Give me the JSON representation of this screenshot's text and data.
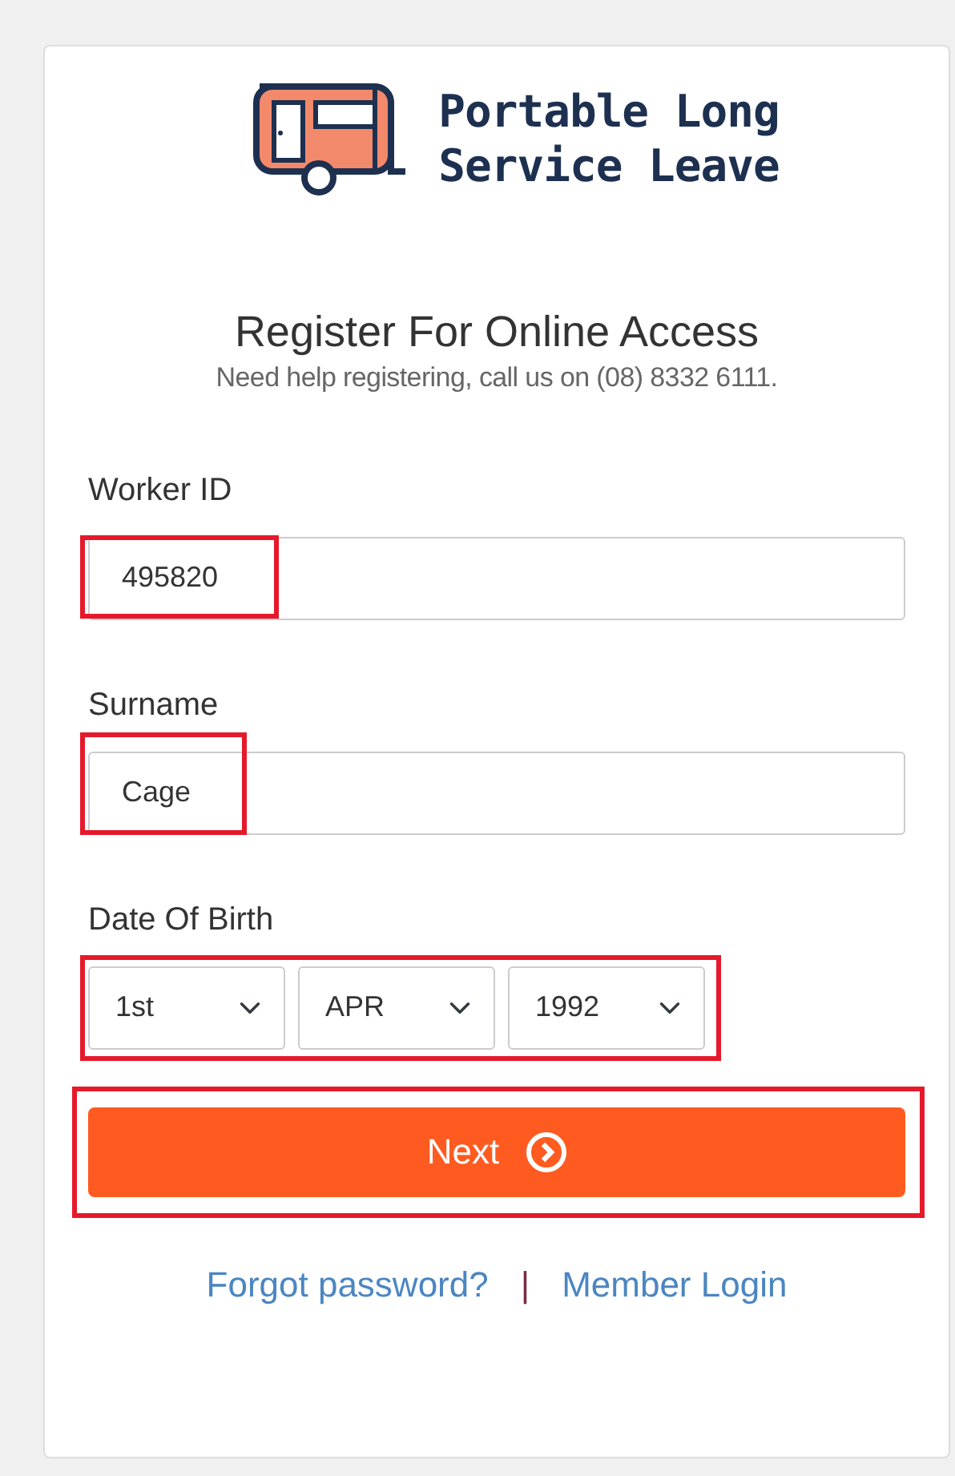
{
  "logo": {
    "lines": [
      "Portable Long",
      "Service Leave"
    ]
  },
  "heading": "Register For Online Access",
  "help_text": "Need help registering, call us on (08) 8332 6111.",
  "fields": [
    {
      "kind": "text",
      "label": "Worker ID",
      "value": "495820",
      "highlighted": true
    },
    {
      "kind": "text",
      "label": "Surname",
      "value": "Cage",
      "highlighted": true
    },
    {
      "kind": "date",
      "label": "Date Of Birth",
      "parts": [
        "1st",
        "APR",
        "1992"
      ],
      "highlighted": true
    }
  ],
  "next_button": {
    "label": "Next",
    "highlighted": true
  },
  "links": [
    "Forgot password?",
    "Member Login"
  ],
  "separator": "|"
}
